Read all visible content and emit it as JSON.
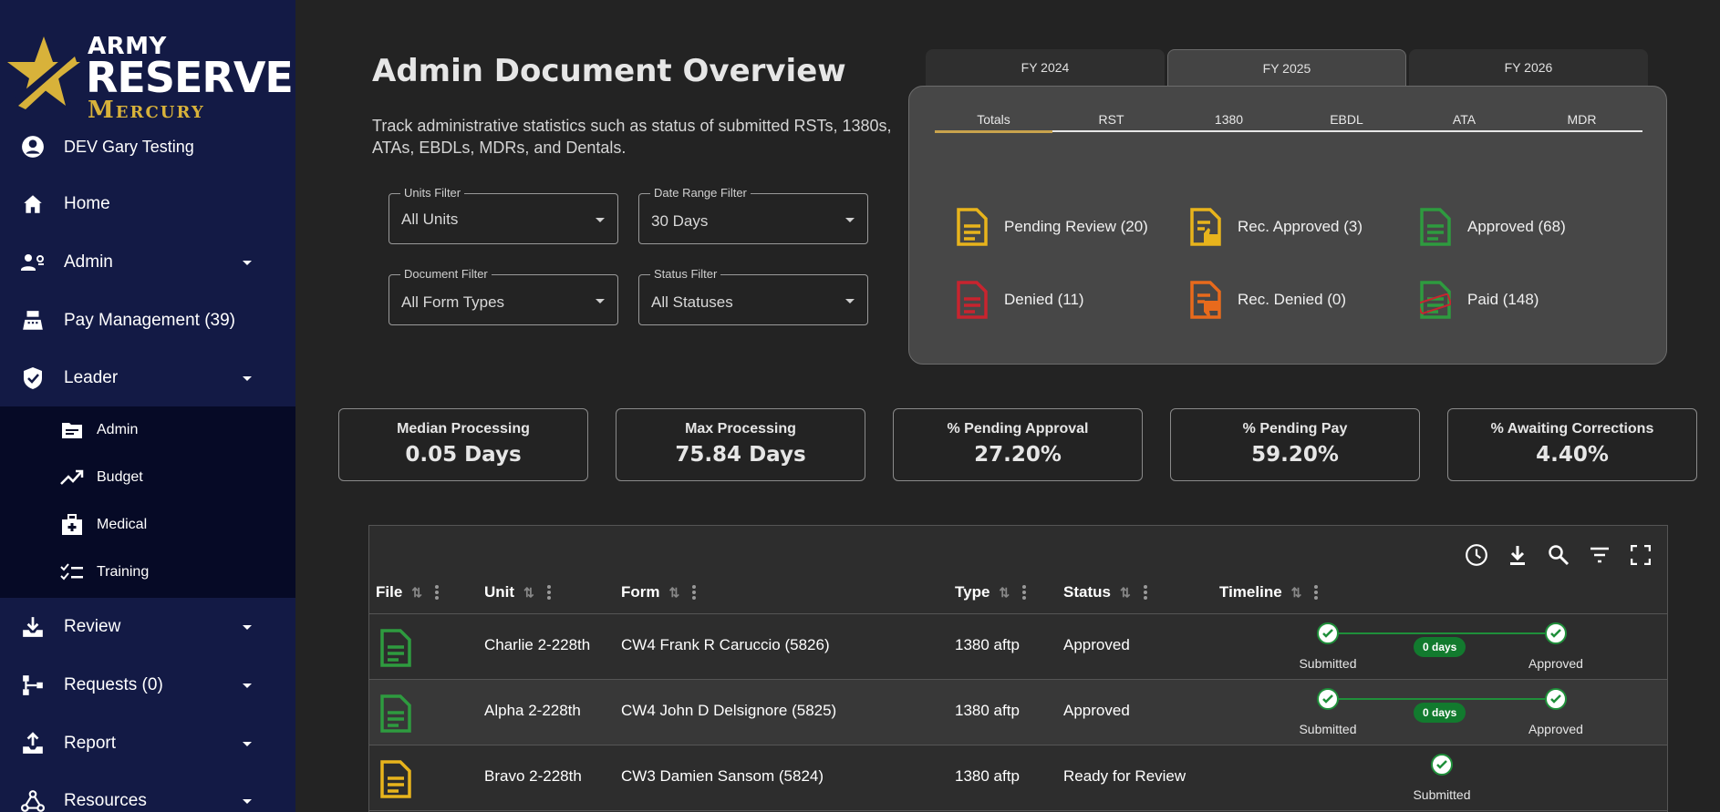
{
  "app": {
    "logo_line1": "ARMY",
    "logo_line2": "RESERVE",
    "logo_line3": "Mercury",
    "brand_gold": "#d8b23a"
  },
  "sidebar": {
    "user": "DEV Gary Testing",
    "items": [
      {
        "label": "Home",
        "icon": "home-icon"
      },
      {
        "label": "Admin",
        "icon": "admin-users-icon"
      },
      {
        "label": "Pay Management (39)",
        "icon": "cash-register-icon"
      },
      {
        "label": "Leader",
        "icon": "shield-check-icon"
      },
      {
        "label": "Review",
        "icon": "download-tray-icon"
      },
      {
        "label": "Requests (0)",
        "icon": "tree-branch-icon"
      },
      {
        "label": "Report",
        "icon": "upload-tray-icon"
      },
      {
        "label": "Resources",
        "icon": "network-icon"
      }
    ],
    "leader_sub": [
      {
        "label": "Admin",
        "icon": "folder-icon"
      },
      {
        "label": "Budget",
        "icon": "trend-up-icon"
      },
      {
        "label": "Medical",
        "icon": "medical-kit-icon"
      },
      {
        "label": "Training",
        "icon": "checklist-icon"
      }
    ]
  },
  "header": {
    "title": "Admin Document Overview",
    "description": "Track administrative statistics such as status of submitted RSTs, 1380s, ATAs, EBDLs, MDRs, and Dentals."
  },
  "filters": {
    "units": {
      "label": "Units Filter",
      "value": "All Units"
    },
    "date": {
      "label": "Date Range Filter",
      "value": "30 Days"
    },
    "document": {
      "label": "Document Filter",
      "value": "All Form Types"
    },
    "status": {
      "label": "Status Filter",
      "value": "All Statuses"
    }
  },
  "fiscal_tabs": [
    "FY 2024",
    "FY 2025",
    "FY 2026"
  ],
  "fiscal_active": "FY 2025",
  "doc_tabs": [
    "Totals",
    "RST",
    "1380",
    "EBDL",
    "ATA",
    "MDR"
  ],
  "doc_active": "Totals",
  "stats": [
    {
      "label": "Pending Review (20)",
      "icon": "document-icon",
      "color": "#e8b41c"
    },
    {
      "label": "Rec. Approved (3)",
      "icon": "document-thumb-up-icon",
      "color": "#e8b41c"
    },
    {
      "label": "Approved (68)",
      "icon": "document-icon",
      "color": "#2e9b3f"
    },
    {
      "label": "Denied (11)",
      "icon": "document-icon",
      "color": "#c8242f"
    },
    {
      "label": "Rec. Denied (0)",
      "icon": "document-thumb-down-icon",
      "color": "#e86a1c"
    },
    {
      "label": "Paid (148)",
      "icon": "document-paid-stamp-icon",
      "color": "#2e9b3f"
    }
  ],
  "kpis": [
    {
      "title": "Median Processing",
      "value": "0.05 Days"
    },
    {
      "title": "Max Processing",
      "value": "75.84 Days"
    },
    {
      "title": "% Pending Approval",
      "value": "27.20%"
    },
    {
      "title": "% Pending Pay",
      "value": "59.20%"
    },
    {
      "title": "% Awaiting Corrections",
      "value": "4.40%"
    }
  ],
  "table": {
    "columns": [
      "File",
      "Unit",
      "Form",
      "Type",
      "Status",
      "Timeline"
    ],
    "rows": [
      {
        "unit": "Charlie 2-228th",
        "form": "CW4 Frank R Caruccio (5826)",
        "type": "1380 aftp",
        "status": "Approved",
        "file_color": "#2e9b3f",
        "timeline": {
          "start": "Submitted",
          "end": "Approved",
          "badge": "0 days"
        }
      },
      {
        "unit": "Alpha 2-228th",
        "form": "CW4 John D Delsignore (5825)",
        "type": "1380 aftp",
        "status": "Approved",
        "file_color": "#2e9b3f",
        "timeline": {
          "start": "Submitted",
          "end": "Approved",
          "badge": "0 days"
        }
      },
      {
        "unit": "Bravo 2-228th",
        "form": "CW3 Damien Sansom (5824)",
        "type": "1380 aftp",
        "status": "Ready for Review",
        "file_color": "#e8b41c",
        "timeline": {
          "start": "Submitted"
        }
      }
    ]
  }
}
